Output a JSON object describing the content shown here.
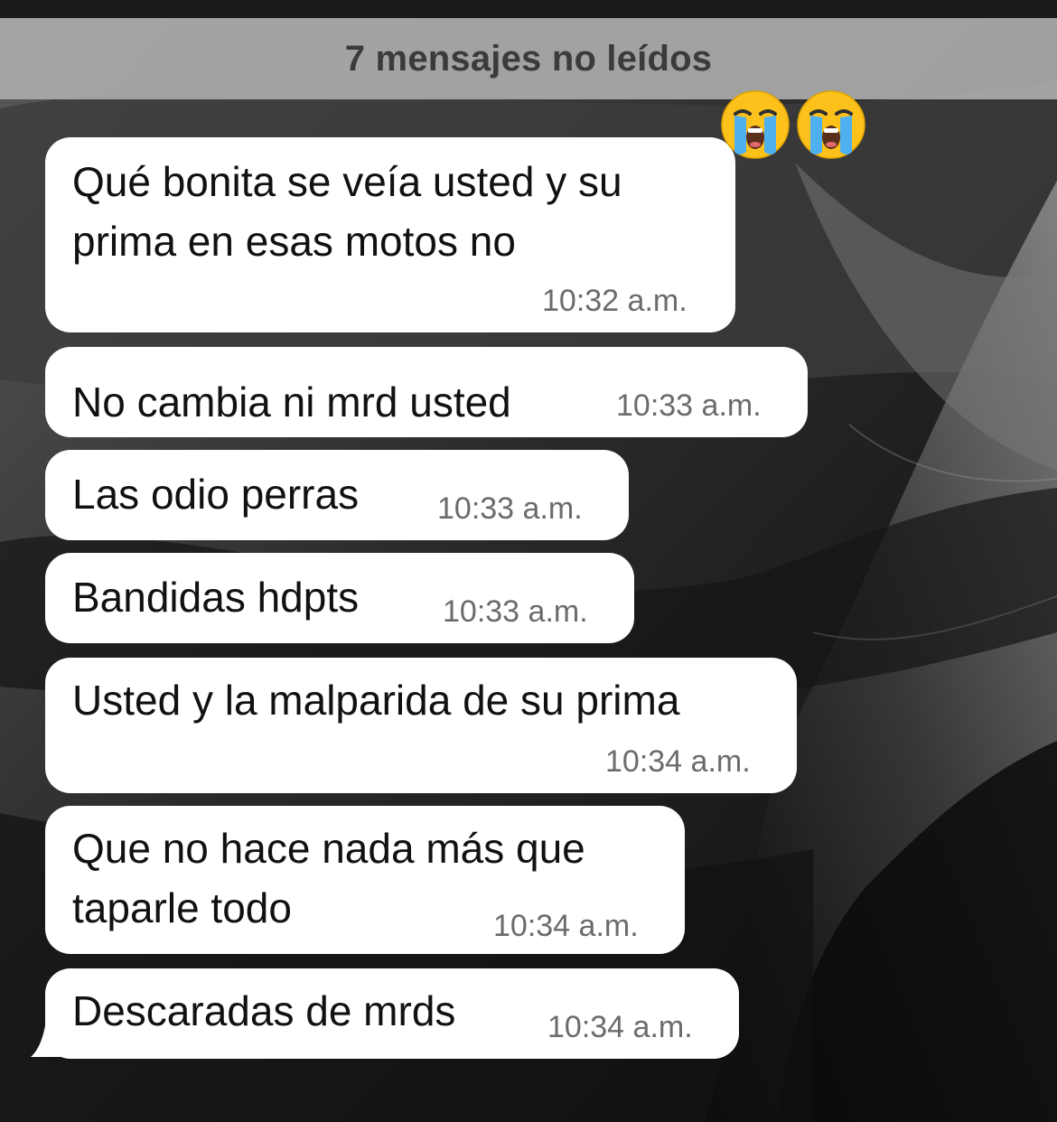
{
  "banner": {
    "unread_label": "7 mensajes no leídos"
  },
  "reactions": {
    "emoji": [
      "😭",
      "😭"
    ],
    "icon": "loudly-crying-face-icon"
  },
  "messages": [
    {
      "lines": [
        "Qué bonita se veía usted y su",
        "prima en esas motos no"
      ],
      "time": "10:32 a.m."
    },
    {
      "lines": [
        "No cambia ni mrd usted"
      ],
      "time": "10:33 a.m."
    },
    {
      "lines": [
        "Las odio perras"
      ],
      "time": "10:33 a.m."
    },
    {
      "lines": [
        "Bandidas hdpts"
      ],
      "time": "10:33 a.m."
    },
    {
      "lines": [
        "Usted y la malparida de su prima"
      ],
      "time": "10:34 a.m."
    },
    {
      "lines": [
        "Que no hace nada más que",
        "taparle todo"
      ],
      "time": "10:34 a.m."
    },
    {
      "lines": [
        "Descaradas de mrds"
      ],
      "time": "10:34 a.m."
    }
  ],
  "colors": {
    "bubble": "#ffffff",
    "banner": "#aaaaaa",
    "timestamp": "#6b6b6b",
    "wallpaper": "#0d0d0d"
  }
}
